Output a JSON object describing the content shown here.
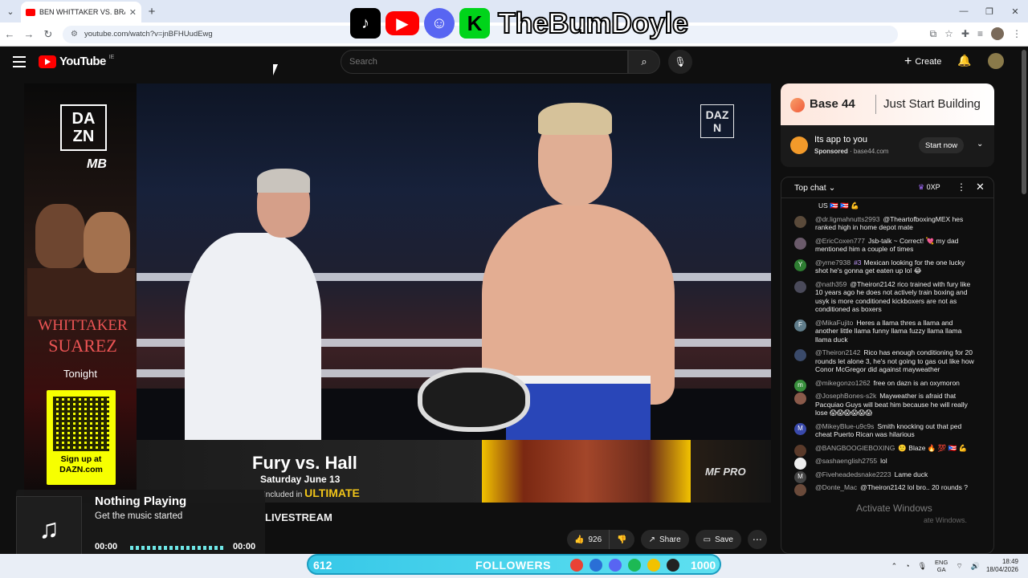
{
  "browser": {
    "tab_title": "BEN WHITTAKER VS. BRAIAN S",
    "url": "youtube.com/watch?v=jnBFHUudEwg"
  },
  "overlay": {
    "channel_name": "TheBumDoyle"
  },
  "youtube": {
    "logo_text": "YouTube",
    "country": "IE",
    "search_placeholder": "Search",
    "create_label": "Create"
  },
  "player": {
    "left_ad": {
      "brand": "DAZN",
      "fighter_line1": "WHITTAKER",
      "fighter_line2": "SUAREZ",
      "tonight": "Tonight",
      "signup": "Sign up at DAZN.com"
    },
    "video_watermark": "DAZN",
    "banner": {
      "title": "Fury vs. Hall",
      "date": "Saturday June 13",
      "included": "Included in",
      "tier": "ULTIMATE",
      "sponsor": "MF PRO"
    }
  },
  "video": {
    "title_fragment": "LIVESTREAM",
    "likes": "926",
    "share_label": "Share",
    "save_label": "Save"
  },
  "now_playing": {
    "title": "Nothing Playing",
    "subtitle": "Get the music started",
    "time_current": "00:00",
    "time_total": "00:00",
    "progress": 0.01
  },
  "ad": {
    "brand": "Base 44",
    "tagline": "Just Start Building",
    "text": "Its app to you",
    "sponsored": "Sponsored",
    "domain": "base44.com",
    "cta": "Start now"
  },
  "chat": {
    "mode": "Top chat",
    "xp": "0XP",
    "messages": [
      {
        "author": "",
        "text": "US 🇵🇷 🇵🇷 💪",
        "avatar": "",
        "color": "#333"
      },
      {
        "author": "@dr.ligmahnutts2993",
        "text": "@TheartofboxingMEX hes ranked high in home depot mate",
        "avatar": "",
        "color": "#5a4a3a"
      },
      {
        "author": "@EricCoxen777",
        "text": "Jsb-talk ~ Correct! 💘 my dad mentioned him a couple of times",
        "avatar": "",
        "color": "#6a5a6a"
      },
      {
        "author": "@yrne7938",
        "badge": "#3",
        "text": "Mexican looking for the one lucky shot he's gonna get eaten up lol 😂",
        "avatar": "Y",
        "color": "#2e7d32"
      },
      {
        "author": "@nath359",
        "text": "@Theiron2142 rico trained with fury like 10 years ago he does not actively train boxing and usyk is more conditioned kickboxers are not as conditioned as boxers",
        "avatar": "",
        "color": "#4a4a5a"
      },
      {
        "author": "@MikaFujito",
        "text": "Heres a llama thres a llama and another little llama funny llama fuzzy llama llama llama duck",
        "avatar": "F",
        "color": "#607d8b"
      },
      {
        "author": "@Theiron2142",
        "text": "Rico has enough conditioning for 20 rounds let alone 3, he's not going to gas out like how Conor McGregor did against mayweather",
        "avatar": "",
        "color": "#3a4a6a"
      },
      {
        "author": "@mikegonzo1262",
        "text": "free on dazn is an oxymoron",
        "avatar": "m",
        "color": "#388e3c"
      },
      {
        "author": "@JosephBones-s2k",
        "text": "Mayweather is afraid that Pacquiao Guys will beat him because he will really lose 😱😱😱😱😱😱",
        "avatar": "",
        "color": "#8a5a4a"
      },
      {
        "author": "@MikeyBlue-u9c9s",
        "text": "Smith knocking out that ped cheat Puerto Rican was hilarious",
        "avatar": "M",
        "color": "#3949ab"
      },
      {
        "author": "@BANGBOOGIEBOXING",
        "text": "🙂 Blaze 🔥 💯 🇵🇷 💪",
        "avatar": "",
        "color": "#5a3a2a"
      },
      {
        "author": "@sashaenglish2755",
        "text": "lol",
        "avatar": "",
        "color": "#eeeeee"
      },
      {
        "author": "@Fiveheadedsnake2223",
        "text": "Lame duck",
        "avatar": "M",
        "color": "#444"
      },
      {
        "author": "@Donte_Mac",
        "text": "@Theiron2142 lol bro.. 20 rounds ?",
        "avatar": "",
        "color": "#6a4a3a"
      }
    ]
  },
  "watermark": {
    "line1": "Activate Windows",
    "line2": "ate Windows."
  },
  "followers": {
    "count": "612",
    "label": "FOLLOWERS",
    "goal": "1000"
  },
  "taskbar": {
    "lang1": "ENG",
    "lang2": "GA",
    "time": "18:49",
    "date": "18/04/2026"
  }
}
